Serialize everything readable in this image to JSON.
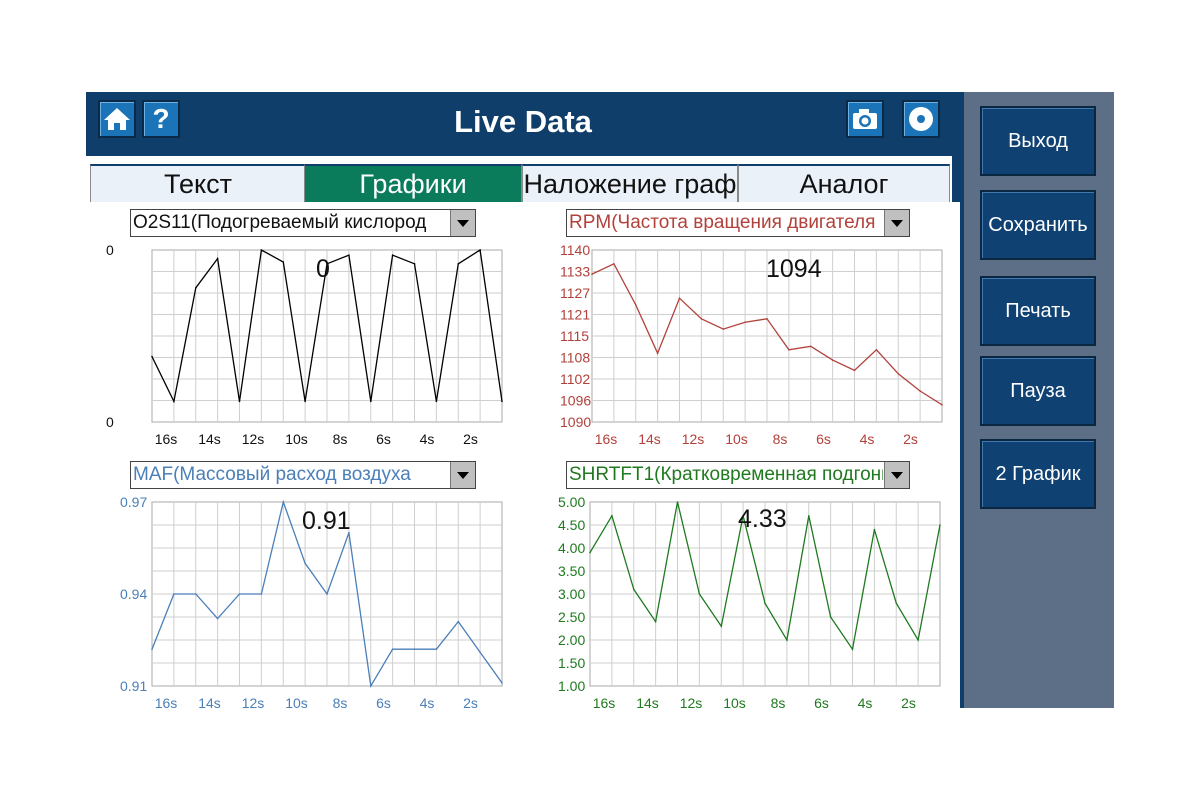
{
  "header": {
    "title": "Live Data",
    "home_icon": "home-icon",
    "help_icon": "help-icon",
    "help_glyph": "?",
    "camera_icon": "camera-icon",
    "record_icon": "record-icon"
  },
  "tabs": [
    {
      "label": "Текст",
      "active": false
    },
    {
      "label": "Графики",
      "active": true
    },
    {
      "label": "Наложение граф",
      "active": false
    },
    {
      "label": "Аналог",
      "active": false
    }
  ],
  "sidebar": {
    "buttons": [
      "Выход",
      "Сохранить",
      "Печать",
      "Пауза",
      "2 График"
    ]
  },
  "colors": {
    "header_bg": "#0e3e69",
    "sidebar_bg": "#5d6f86",
    "button_bg": "#0f4172",
    "active_tab": "#0a7c5c"
  },
  "charts": [
    {
      "selector": "O2S11(Подогреваемый кислород",
      "current_value": "0",
      "color": "#000000",
      "y_ticks": [
        "0",
        "0"
      ],
      "x_ticks": [
        "16s",
        "14s",
        "12s",
        "10s",
        "8s",
        "6s",
        "4s",
        "2s"
      ]
    },
    {
      "selector": "RPM(Частота вращения двигателя",
      "current_value": "1094",
      "color": "#b2413b",
      "y_ticks": [
        "1140",
        "1133",
        "1127",
        "1121",
        "1115",
        "1108",
        "1102",
        "1096",
        "1090"
      ],
      "x_ticks": [
        "16s",
        "14s",
        "12s",
        "10s",
        "8s",
        "6s",
        "4s",
        "2s"
      ]
    },
    {
      "selector": "MAF(Массовый расход воздуха",
      "current_value": "0.91",
      "color": "#4a7fb8",
      "y_ticks": [
        "0.97",
        "0.94",
        "0.91"
      ],
      "x_ticks": [
        "16s",
        "14s",
        "12s",
        "10s",
        "8s",
        "6s",
        "4s",
        "2s"
      ]
    },
    {
      "selector": "SHRTFT1(Кратковременная подгонка",
      "current_value": "4.33",
      "color": "#1f7a1f",
      "y_ticks": [
        "5.00",
        "4.50",
        "4.00",
        "3.50",
        "3.00",
        "2.50",
        "2.00",
        "1.50",
        "1.00"
      ],
      "x_ticks": [
        "16s",
        "14s",
        "12s",
        "10s",
        "8s",
        "6s",
        "4s",
        "2s"
      ]
    }
  ],
  "chart_data": [
    {
      "type": "line",
      "title": "O2S11(Подогреваемый кислород",
      "ylim": [
        0,
        1
      ],
      "x": [
        0,
        1,
        2,
        3,
        4,
        5,
        6,
        7,
        8,
        9,
        10,
        11,
        12,
        13,
        14,
        15,
        16
      ],
      "values": [
        0.38,
        0.12,
        0.78,
        0.95,
        0.12,
        1.0,
        0.93,
        0.12,
        0.92,
        0.97,
        0.12,
        0.97,
        0.92,
        0.12,
        0.92,
        1.0,
        0.12
      ]
    },
    {
      "type": "line",
      "title": "RPM(Частота вращения двигателя",
      "ylim": [
        1090,
        1140
      ],
      "x": [
        0,
        1,
        2,
        3,
        4,
        5,
        6,
        7,
        8,
        9,
        10,
        11,
        12,
        13,
        14,
        15,
        16
      ],
      "values": [
        1133,
        1136,
        1124,
        1110,
        1126,
        1120,
        1117,
        1119,
        1120,
        1111,
        1112,
        1108,
        1105,
        1111,
        1104,
        1099,
        1095
      ]
    },
    {
      "type": "line",
      "title": "MAF(Массовый расход воздуха",
      "ylim": [
        0.91,
        0.97
      ],
      "x": [
        0,
        1,
        2,
        3,
        4,
        5,
        6,
        7,
        8,
        9,
        10,
        11,
        12,
        13,
        14,
        15,
        16
      ],
      "values": [
        0.922,
        0.94,
        0.94,
        0.932,
        0.94,
        0.94,
        0.97,
        0.95,
        0.94,
        0.96,
        0.91,
        0.922,
        0.922,
        0.922,
        0.931,
        0.921,
        0.911
      ]
    },
    {
      "type": "line",
      "title": "SHRTFT1(Кратковременная подгонка",
      "ylim": [
        1.0,
        5.0
      ],
      "x": [
        0,
        1,
        2,
        3,
        4,
        5,
        6,
        7,
        8,
        9,
        10,
        11,
        12,
        13,
        14,
        15,
        16
      ],
      "values": [
        3.9,
        4.7,
        3.1,
        2.4,
        5.0,
        3.0,
        2.3,
        4.7,
        2.8,
        2.0,
        4.7,
        2.5,
        1.8,
        4.4,
        2.8,
        2.0,
        4.5
      ]
    }
  ]
}
